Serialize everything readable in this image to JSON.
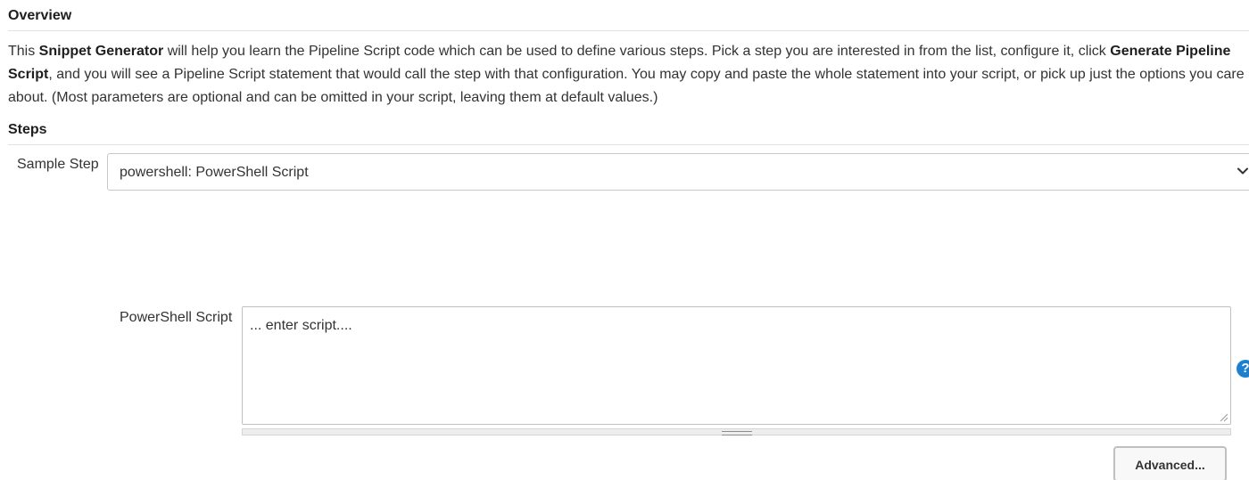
{
  "overview": {
    "header": "Overview",
    "intro_1": "This ",
    "snippet_generator": "Snippet Generator",
    "intro_2": " will help you learn the Pipeline Script code which can be used to define various steps. Pick a step you are interested in from the list, configure it, click ",
    "generate_pipeline_script": "Generate Pipeline Script",
    "intro_3": ", and you will see a Pipeline Script statement that would call the step with that configuration. You may copy and paste the whole statement into your script, or pick up just the options you care about. (Most parameters are optional and can be omitted in your script, leaving them at default values.)"
  },
  "steps": {
    "header": "Steps",
    "sample_step_label": "Sample Step",
    "sample_step_value": "powershell: PowerShell Script",
    "powershell_label": "PowerShell Script",
    "script_placeholder": "... enter script....",
    "help_icon_glyph": "?",
    "advanced_label": "Advanced..."
  },
  "colors": {
    "help_icon": "#1c7fd0"
  }
}
